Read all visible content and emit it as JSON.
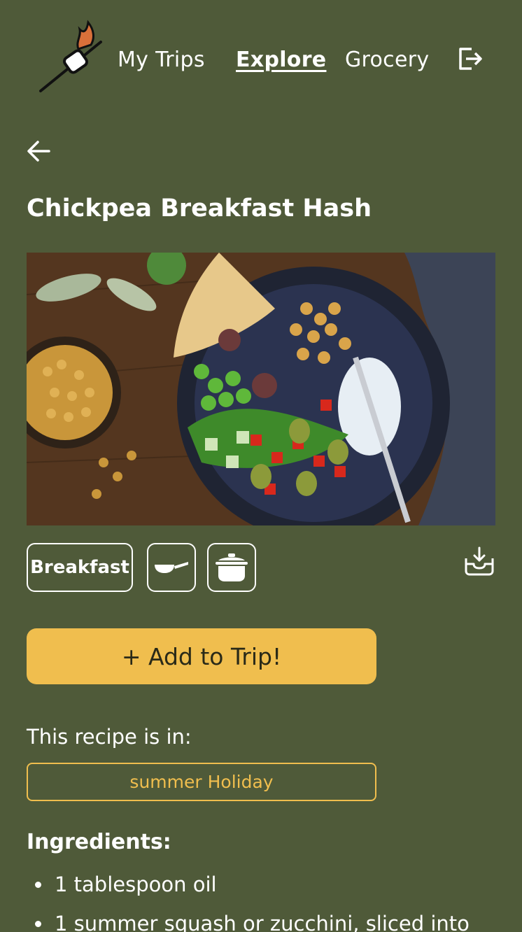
{
  "nav": {
    "logo_icon": "marshmallow-roast-icon",
    "links": [
      {
        "label": "My Trips",
        "active": false
      },
      {
        "label": "Explore",
        "active": true
      },
      {
        "label": "Grocery",
        "active": false
      }
    ],
    "logout_icon": "logout-icon"
  },
  "back_icon": "arrow-left-icon",
  "recipe": {
    "title": "Chickpea Breakfast Hash",
    "image_icon": "food-photo",
    "tags": {
      "meal": "Breakfast",
      "equipment_icons": [
        "frying-pan-icon",
        "cooking-pot-icon"
      ]
    },
    "save_icon": "download-tray-icon",
    "add_button_label": "+ Add to Trip!",
    "in_label": "This recipe is in:",
    "trips": [
      "summer Holiday"
    ],
    "ingredients_title": "Ingredients:",
    "ingredients": [
      "1 tablespoon oil",
      "1 summer squash or zucchini, sliced into"
    ]
  },
  "colors": {
    "background": "#4f5a39",
    "accent": "#f0be4e",
    "text": "#ffffff"
  }
}
